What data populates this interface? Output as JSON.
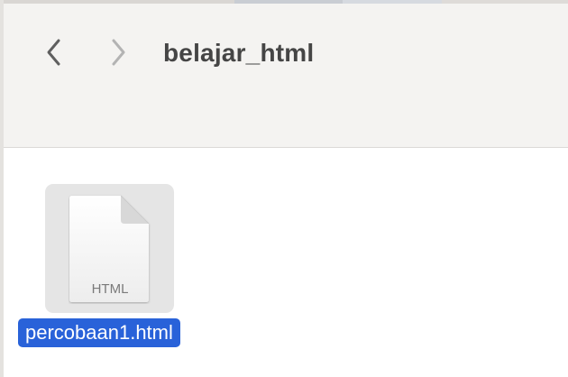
{
  "window": {
    "title": "belajar_html"
  },
  "toolbar": {
    "back_icon": "chevron-left-icon",
    "forward_icon": "chevron-right-icon"
  },
  "files": [
    {
      "name": "percobaan1.html",
      "type_label": "HTML",
      "icon": "html-document-icon",
      "selected": true
    }
  ],
  "colors": {
    "selection": "#2962d9",
    "toolbar_bg": "#f4f3f1",
    "icon_highlight": "#e5e5e5"
  }
}
